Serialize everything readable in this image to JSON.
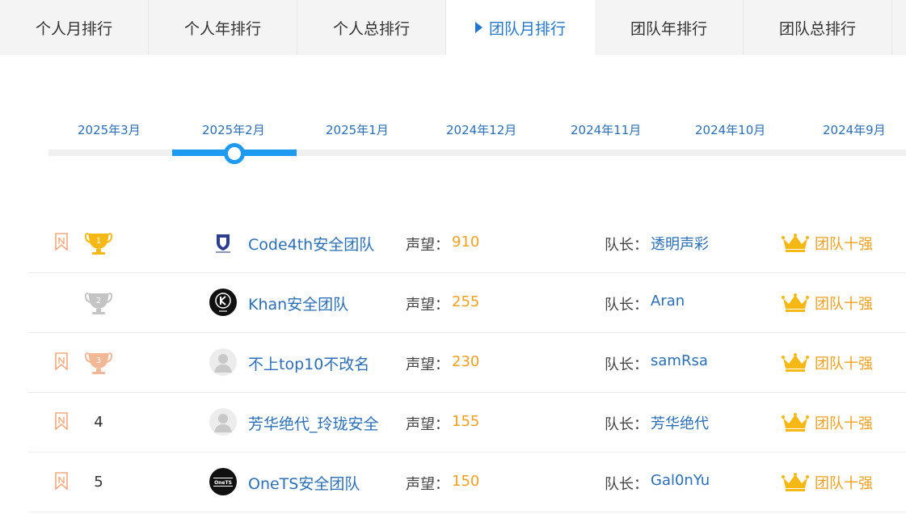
{
  "tabs": [
    {
      "label": "个人月排行",
      "active": false
    },
    {
      "label": "个人年排行",
      "active": false
    },
    {
      "label": "个人总排行",
      "active": false
    },
    {
      "label": "团队月排行",
      "active": true
    },
    {
      "label": "团队年排行",
      "active": false
    },
    {
      "label": "团队总排行",
      "active": false
    }
  ],
  "timeline": {
    "months": [
      "2025年3月",
      "2025年2月",
      "2025年1月",
      "2024年12月",
      "2024年11月",
      "2024年10月",
      "2024年9月"
    ],
    "selected": "2025年2月"
  },
  "labels": {
    "reputation": "声望：",
    "captain": "队长：",
    "badge": "团队十强"
  },
  "rows": [
    {
      "rank": "1",
      "rank_style": "gold-trophy",
      "bookmarked": true,
      "avatar": "shield-logo",
      "team": "Code4th安全团队",
      "reputation": "910",
      "captain": "透明声彩"
    },
    {
      "rank": "2",
      "rank_style": "silver-trophy",
      "bookmarked": false,
      "avatar": "K-logo",
      "team": "Khan安全团队",
      "reputation": "255",
      "captain": "Aran"
    },
    {
      "rank": "3",
      "rank_style": "bronze-trophy",
      "bookmarked": true,
      "avatar": "default-user",
      "team": "不上top10不改名",
      "reputation": "230",
      "captain": "samRsa"
    },
    {
      "rank": "4",
      "rank_style": "number",
      "bookmarked": true,
      "avatar": "default-user",
      "team": "芳华绝代_玲珑安全",
      "reputation": "155",
      "captain": "芳华绝代"
    },
    {
      "rank": "5",
      "rank_style": "number",
      "bookmarked": true,
      "avatar": "onets-logo",
      "team": "OneTS安全团队",
      "reputation": "150",
      "captain": "Gal0nYu"
    }
  ],
  "colors": {
    "accent": "#2a6fb7",
    "timeline_active": "#1e9bf0",
    "reputation": "#f0a020",
    "gold": "#f5b815",
    "silver": "#c4c4c4",
    "bronze": "#f2b896",
    "bookmark": "#f4a87c"
  }
}
